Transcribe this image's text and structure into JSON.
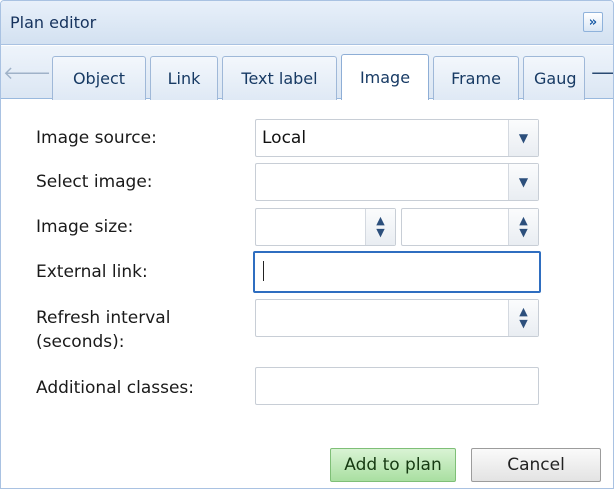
{
  "panel": {
    "title": "Plan editor",
    "collapse_icon": "»"
  },
  "tabs": [
    {
      "label": "Object",
      "active": false
    },
    {
      "label": "Link",
      "active": false
    },
    {
      "label": "Text label",
      "active": false
    },
    {
      "label": "Image",
      "active": true
    },
    {
      "label": "Frame",
      "active": false
    },
    {
      "label": "Gaug",
      "active": false
    }
  ],
  "tab_scroll": {
    "left_icon": "arrow-left-icon",
    "right_icon": "arrow-right-icon"
  },
  "form": {
    "image_source": {
      "label": "Image source:",
      "value": "Local"
    },
    "select_image": {
      "label": "Select image:",
      "value": ""
    },
    "image_size": {
      "label": "Image size:",
      "width": "",
      "height": ""
    },
    "external_link": {
      "label": "External link:",
      "value": ""
    },
    "refresh_interval": {
      "label_line1": "Refresh interval",
      "label_line2": "(seconds):",
      "value": ""
    },
    "additional_classes": {
      "label": "Additional classes:",
      "value": ""
    }
  },
  "actions": {
    "add_label": "Add to plan",
    "cancel_label": "Cancel"
  }
}
